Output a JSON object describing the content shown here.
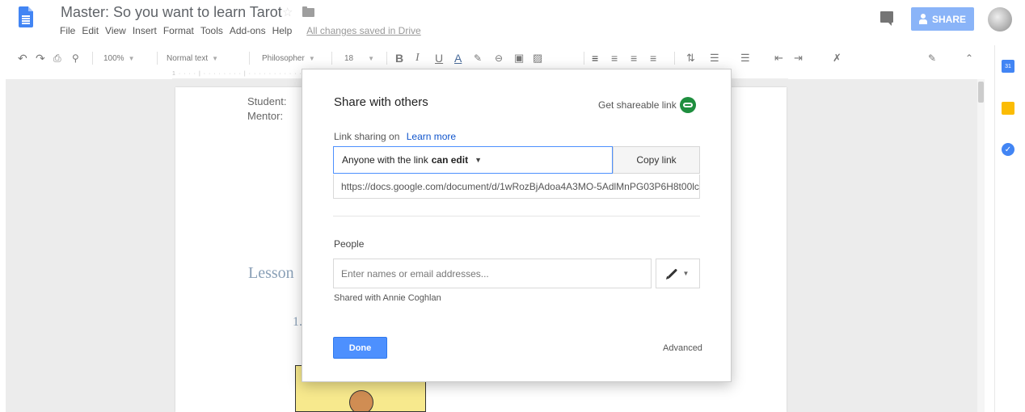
{
  "header": {
    "doc_title": "Master: So you want to learn Tarot",
    "menu": [
      "File",
      "Edit",
      "View",
      "Insert",
      "Format",
      "Tools",
      "Add-ons",
      "Help"
    ],
    "save_status": "All changes saved in Drive",
    "share_label": "SHARE"
  },
  "toolbar": {
    "zoom": "100%",
    "style": "Normal text",
    "font": "Philosopher",
    "size": "18"
  },
  "document": {
    "student_label": "Student:",
    "mentor_label": "Mentor:",
    "lesson_heading": "Lesson",
    "list_number": "1."
  },
  "dialog": {
    "title": "Share with others",
    "get_link_label": "Get shareable link",
    "sharing_status": "Link sharing on",
    "learn_more": "Learn more",
    "permission_prefix": "Anyone with the link",
    "permission_value": "can edit",
    "copy_link_label": "Copy link",
    "url": "https://docs.google.com/document/d/1wRozBjAdoa4A3MO-5AdlMnPG03P6H8t00lc",
    "people_label": "People",
    "people_placeholder": "Enter names or email addresses...",
    "shared_with": "Shared with Annie Coghlan",
    "done_label": "Done",
    "advanced_label": "Advanced"
  },
  "side_panel": {
    "calendar_day": "31"
  },
  "colors": {
    "accent_blue": "#4d90fe",
    "share_button": "#8ab4f8",
    "link_green": "#1e8e3e",
    "docs_blue": "#4285f4"
  }
}
